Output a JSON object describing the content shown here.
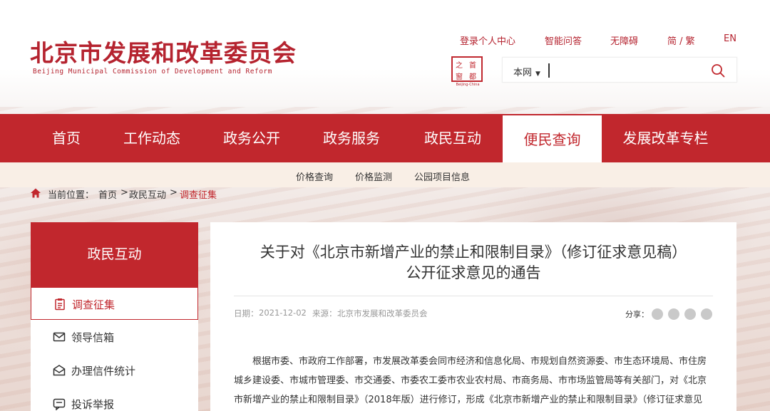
{
  "header": {
    "site_title": "北京市发展和改革委员会",
    "site_subtitle": "Beijing Municipal Commission of Development and Reform",
    "links": [
      "登录个人中心",
      "智能问答",
      "无障碍",
      "简 / 繁",
      "EN"
    ],
    "seal": {
      "chars": [
        "首",
        "都",
        "之",
        "窗"
      ],
      "caption": "Beijing-China"
    },
    "search": {
      "scope": "本网",
      "value": "",
      "placeholder": ""
    }
  },
  "nav": {
    "items": [
      "首页",
      "工作动态",
      "政务公开",
      "政务服务",
      "政民互动",
      "便民查询",
      "发展改革专栏"
    ],
    "active_index": 5
  },
  "subnav": [
    "价格查询",
    "价格监测",
    "公园项目信息"
  ],
  "breadcrumb": {
    "label": "当前位置：",
    "home": "首页",
    "sep1": ">",
    "mid": "政民互动",
    "sep2": ">",
    "current": "调查征集"
  },
  "sidebar": {
    "title": "政民互动",
    "items": [
      {
        "label": "调查征集",
        "icon": "clipboard-icon",
        "active": true
      },
      {
        "label": "领导信箱",
        "icon": "mail-icon",
        "active": false
      },
      {
        "label": "办理信件统计",
        "icon": "mail-stats-icon",
        "active": false
      },
      {
        "label": "投诉举报",
        "icon": "chat-icon",
        "active": false
      }
    ]
  },
  "article": {
    "title_line1": "关于对《北京市新增产业的禁止和限制目录》（修订征求意见稿）",
    "title_line2": "公开征求意见的通告",
    "date_label": "日期：",
    "date": "2021-12-02",
    "source_label": "来源：",
    "source": "北京市发展和改革委员会",
    "share_label": "分享：",
    "body": "根据市委、市政府工作部署，市发展改革委会同市经济和信息化局、市规划自然资源委、市生态环境局、市住房城乡建设委、市城市管理委、市交通委、市委农工委市农业农村局、市商务局、市市场监管局等有关部门，对《北京市新增产业的禁止和限制目录》（2018年版）进行修订，形成《北京市新增产业的禁止和限制目录》（修订征求意见稿），现向社会公开征求意见。"
  },
  "colors": {
    "brand_red": "#c1272d",
    "subnav_bg": "#f9efe6"
  }
}
